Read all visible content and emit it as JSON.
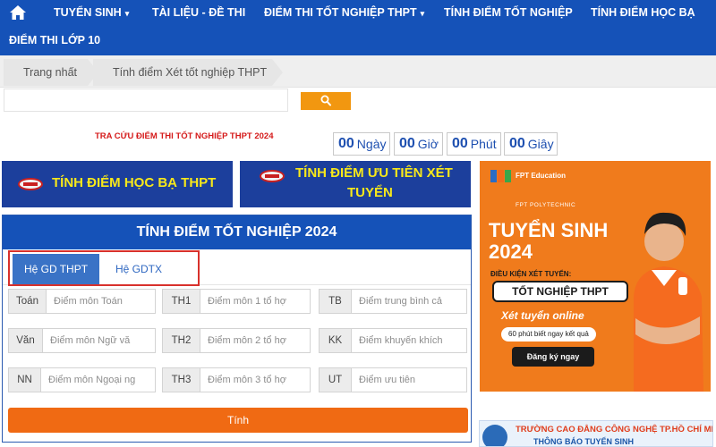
{
  "nav": {
    "items": [
      {
        "label": "TUYỂN SINH",
        "dropdown": true
      },
      {
        "label": "TÀI LIỆU - ĐỀ THI",
        "dropdown": false
      },
      {
        "label": "ĐIỂM THI TỐT NGHIỆP THPT",
        "dropdown": true
      },
      {
        "label": "TÍNH ĐIỂM TỐT NGHIỆP",
        "dropdown": false
      },
      {
        "label": "TÍNH ĐIỂM HỌC BẠ",
        "dropdown": false
      },
      {
        "label": "ĐIỂM THI LỚP 10",
        "dropdown": false
      }
    ],
    "caret": "▾"
  },
  "breadcrumb": [
    "Trang nhất",
    "Tính điểm Xét tốt nghiệp THPT"
  ],
  "search": {
    "placeholder": "",
    "icon": "search-icon"
  },
  "lookup_text": "TRA CỨU ĐIỂM THI TỐT NGHIỆP THPT 2024",
  "countdown": [
    {
      "value": "00",
      "unit": "Ngày"
    },
    {
      "value": "00",
      "unit": "Giờ"
    },
    {
      "value": "00",
      "unit": "Phút"
    },
    {
      "value": "00",
      "unit": "Giây"
    }
  ],
  "banners": {
    "hoc_ba": "TÍNH ĐIỂM HỌC BẠ THPT",
    "uu_tien_line1": "TÍNH ĐIỂM ƯU TIÊN XÉT",
    "uu_tien_line2": "TUYỂN"
  },
  "calculator": {
    "title": "TÍNH ĐIỂM TỐT NGHIỆP 2024",
    "tabs": [
      "Hệ GD THPT",
      "Hệ GDTX"
    ],
    "active_tab": "Hệ GD THPT",
    "fields": [
      {
        "label": "Toán",
        "placeholder": "Điểm môn Toán"
      },
      {
        "label": "TH1",
        "placeholder": "Điểm môn 1 tổ hợ"
      },
      {
        "label": "TB",
        "placeholder": "Điểm trung bình cả"
      },
      {
        "label": "Văn",
        "placeholder": "Điểm môn Ngữ vă"
      },
      {
        "label": "TH2",
        "placeholder": "Điểm môn 2 tổ hợ"
      },
      {
        "label": "KK",
        "placeholder": "Điểm khuyến khích"
      },
      {
        "label": "NN",
        "placeholder": "Điểm môn Ngoại ng"
      },
      {
        "label": "TH3",
        "placeholder": "Điểm môn 3 tổ hợ"
      },
      {
        "label": "UT",
        "placeholder": "Điểm ưu tiên"
      }
    ],
    "submit_label": "Tính"
  },
  "ad_fpt": {
    "brand": "FPT Education",
    "school": "FPT POLYTECHNIC",
    "title_line1": "TUYỂN SINH",
    "title_line2": "2024",
    "sub": "ĐIỀU KIỆN XÉT TUYỂN:",
    "pill": "TỐT NGHIỆP THPT",
    "online": "Xét tuyển online",
    "fast": "60 phút biết ngay kết quả",
    "cta": "Đăng ký ngay"
  },
  "ad_college": {
    "line1": "TRƯỜNG CAO ĐẲNG CÔNG NGHỆ TP.HỒ CHÍ MINH",
    "line2": "THÔNG BÁO TUYỂN SINH"
  },
  "colors": {
    "nav": "#1552b8",
    "accent": "#f29710",
    "submit": "#f06a13",
    "banner": "#1c3f9c",
    "banner_text": "#f7e81a",
    "highlight": "#d8312c"
  }
}
